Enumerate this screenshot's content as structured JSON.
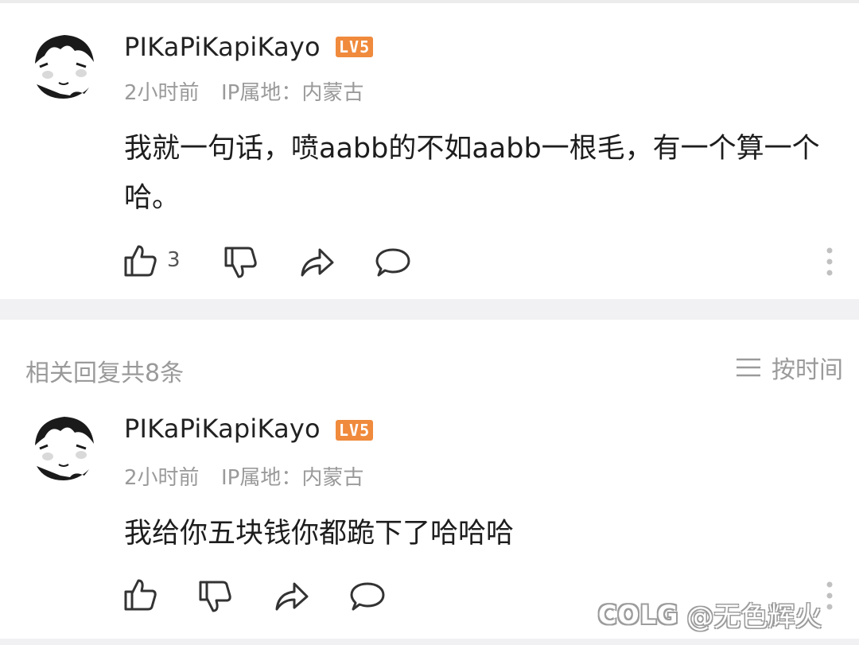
{
  "comment": {
    "username": "PIKaPiKapiKayo",
    "level_badge": "LV5",
    "time": "2小时前",
    "ip_location": "IP属地：内蒙古",
    "text": "我就一句话，喷aabb的不如aabb一根毛，有一个算一个哈。",
    "like_count": "3"
  },
  "related": {
    "title": "相关回复共8条",
    "sort_label": "按时间"
  },
  "reply": {
    "username": "PIKaPiKapiKayo",
    "level_badge": "LV5",
    "time": "2小时前",
    "ip_location": "IP属地：内蒙古",
    "text": "我给你五块钱你都跪下了哈哈哈"
  },
  "watermark": {
    "logo": "COLG",
    "text": "@无色辉火"
  },
  "colors": {
    "level_badge": "#f08a3c",
    "meta_text": "#9a9a9a",
    "divider": "#f1f1f3"
  },
  "icons": [
    "thumbs-up-icon",
    "thumbs-down-icon",
    "share-icon",
    "comment-icon",
    "more-vertical-icon",
    "sort-list-icon"
  ]
}
